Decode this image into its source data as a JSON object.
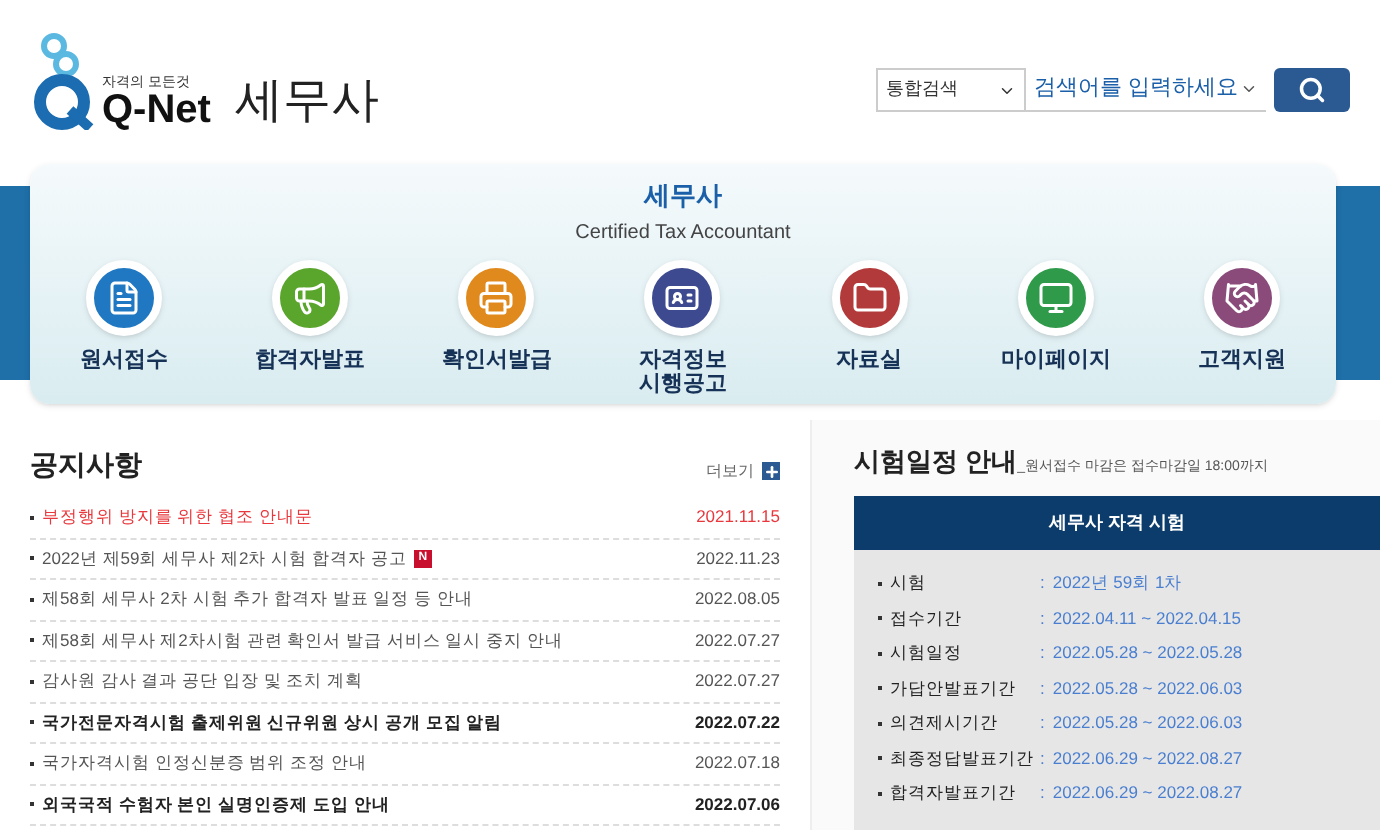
{
  "logo": {
    "tagline": "자격의 모든것",
    "wordmark": "Q-Net"
  },
  "page_title": "세무사",
  "search": {
    "scope": "통합검색",
    "placeholder": "검색어를 입력하세요"
  },
  "banner": {
    "title": "세무사",
    "subtitle": "Certified Tax Accountant"
  },
  "menu": [
    {
      "label": "원서접수",
      "color": "#1f78c1"
    },
    {
      "label": "합격자발표",
      "color": "#5aa52c"
    },
    {
      "label": "확인서발급",
      "color": "#e08a1e"
    },
    {
      "label": "자격정보\n시행공고",
      "color": "#3d4a8f"
    },
    {
      "label": "자료실",
      "color": "#b33a3a"
    },
    {
      "label": "마이페이지",
      "color": "#2f9a4a"
    },
    {
      "label": "고객지원",
      "color": "#8a4a7a"
    }
  ],
  "notices": {
    "title": "공지사항",
    "more": "더보기",
    "items": [
      {
        "kind": "alert",
        "title": "부정행위 방지를 위한 협조 안내문",
        "date": "2021.11.15"
      },
      {
        "kind": "normal",
        "title": "2022년 제59회 세무사 제2차 시험 합격자 공고",
        "badge": "N",
        "date": "2022.11.23"
      },
      {
        "kind": "normal",
        "title": "제58회 세무사 2차 시험 추가 합격자 발표 일정 등 안내",
        "date": "2022.08.05"
      },
      {
        "kind": "normal",
        "title": "제58회 세무사 제2차시험 관련 확인서 발급 서비스 일시 중지 안내",
        "date": "2022.07.27"
      },
      {
        "kind": "normal",
        "title": "감사원 감사 결과 공단 입장 및 조치 계획",
        "date": "2022.07.27"
      },
      {
        "kind": "bold",
        "title": "국가전문자격시험 출제위원 신규위원 상시 공개 모집 알림",
        "date": "2022.07.22"
      },
      {
        "kind": "normal",
        "title": "국가자격시험 인정신분증 범위 조정 안내",
        "date": "2022.07.18"
      },
      {
        "kind": "bold",
        "title": "외국국적 수험자 본인 실명인증제 도입 안내",
        "date": "2022.07.06"
      }
    ]
  },
  "schedule": {
    "title": "시험일정 안내",
    "note": "_원서접수 마감은 접수마감일 18:00까지",
    "box_title": "세무사 자격 시험",
    "separator": ":",
    "rows": [
      {
        "label": "시험",
        "value": "2022년 59회 1차"
      },
      {
        "label": "접수기간",
        "value": "2022.04.11 ~ 2022.04.15"
      },
      {
        "label": "시험일정",
        "value": "2022.05.28 ~ 2022.05.28"
      },
      {
        "label": "가답안발표기간",
        "value": "2022.05.28 ~ 2022.06.03"
      },
      {
        "label": "의견제시기간",
        "value": "2022.05.28 ~ 2022.06.03"
      },
      {
        "label": "최종정답발표기간",
        "value": "2022.06.29 ~ 2022.08.27"
      },
      {
        "label": "합격자발표기간",
        "value": "2022.06.29 ~ 2022.08.27"
      }
    ]
  }
}
